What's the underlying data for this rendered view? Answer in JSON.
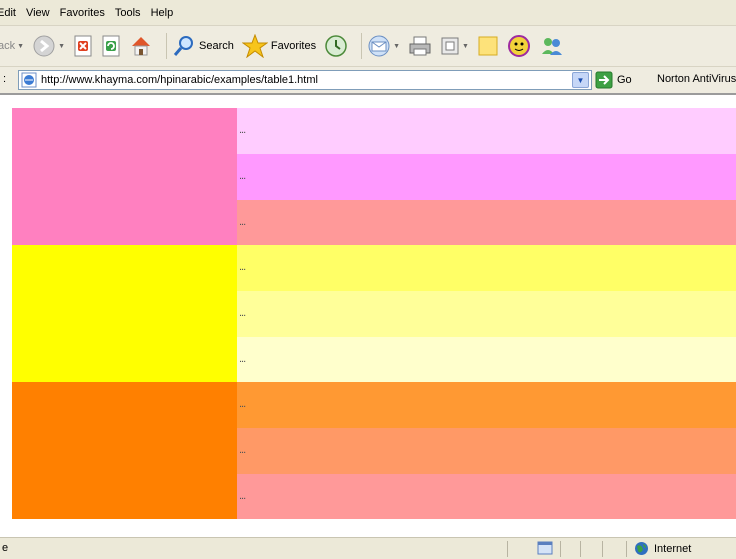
{
  "menu": [
    "Edit",
    "View",
    "Favorites",
    "Tools",
    "Help"
  ],
  "toolbar": {
    "back_label": "ack",
    "search_label": "Search",
    "favorites_label": "Favorites"
  },
  "address": {
    "url": "http://www.khayma.com/hpinarabic/examples/table1.html",
    "go_label": "Go",
    "norton_label": "Norton AntiVirus"
  },
  "table": {
    "groups": [
      {
        "color": "#ff80c0",
        "rows": [
          {
            "color": "#ffccff",
            "text": "..."
          },
          {
            "color": "#ff99ff",
            "text": "..."
          },
          {
            "color": "#ff9999",
            "text": "..."
          }
        ]
      },
      {
        "color": "#ffff00",
        "rows": [
          {
            "color": "#ffff66",
            "text": "..."
          },
          {
            "color": "#ffff99",
            "text": "..."
          },
          {
            "color": "#ffffcc",
            "text": "..."
          }
        ]
      },
      {
        "color": "#ff8000",
        "rows": [
          {
            "color": "#ff9933",
            "text": "..."
          },
          {
            "color": "#ff9966",
            "text": "..."
          },
          {
            "color": "#ff9999",
            "text": "..."
          }
        ]
      }
    ]
  },
  "status": {
    "text": "e",
    "zone_label": "Internet"
  }
}
